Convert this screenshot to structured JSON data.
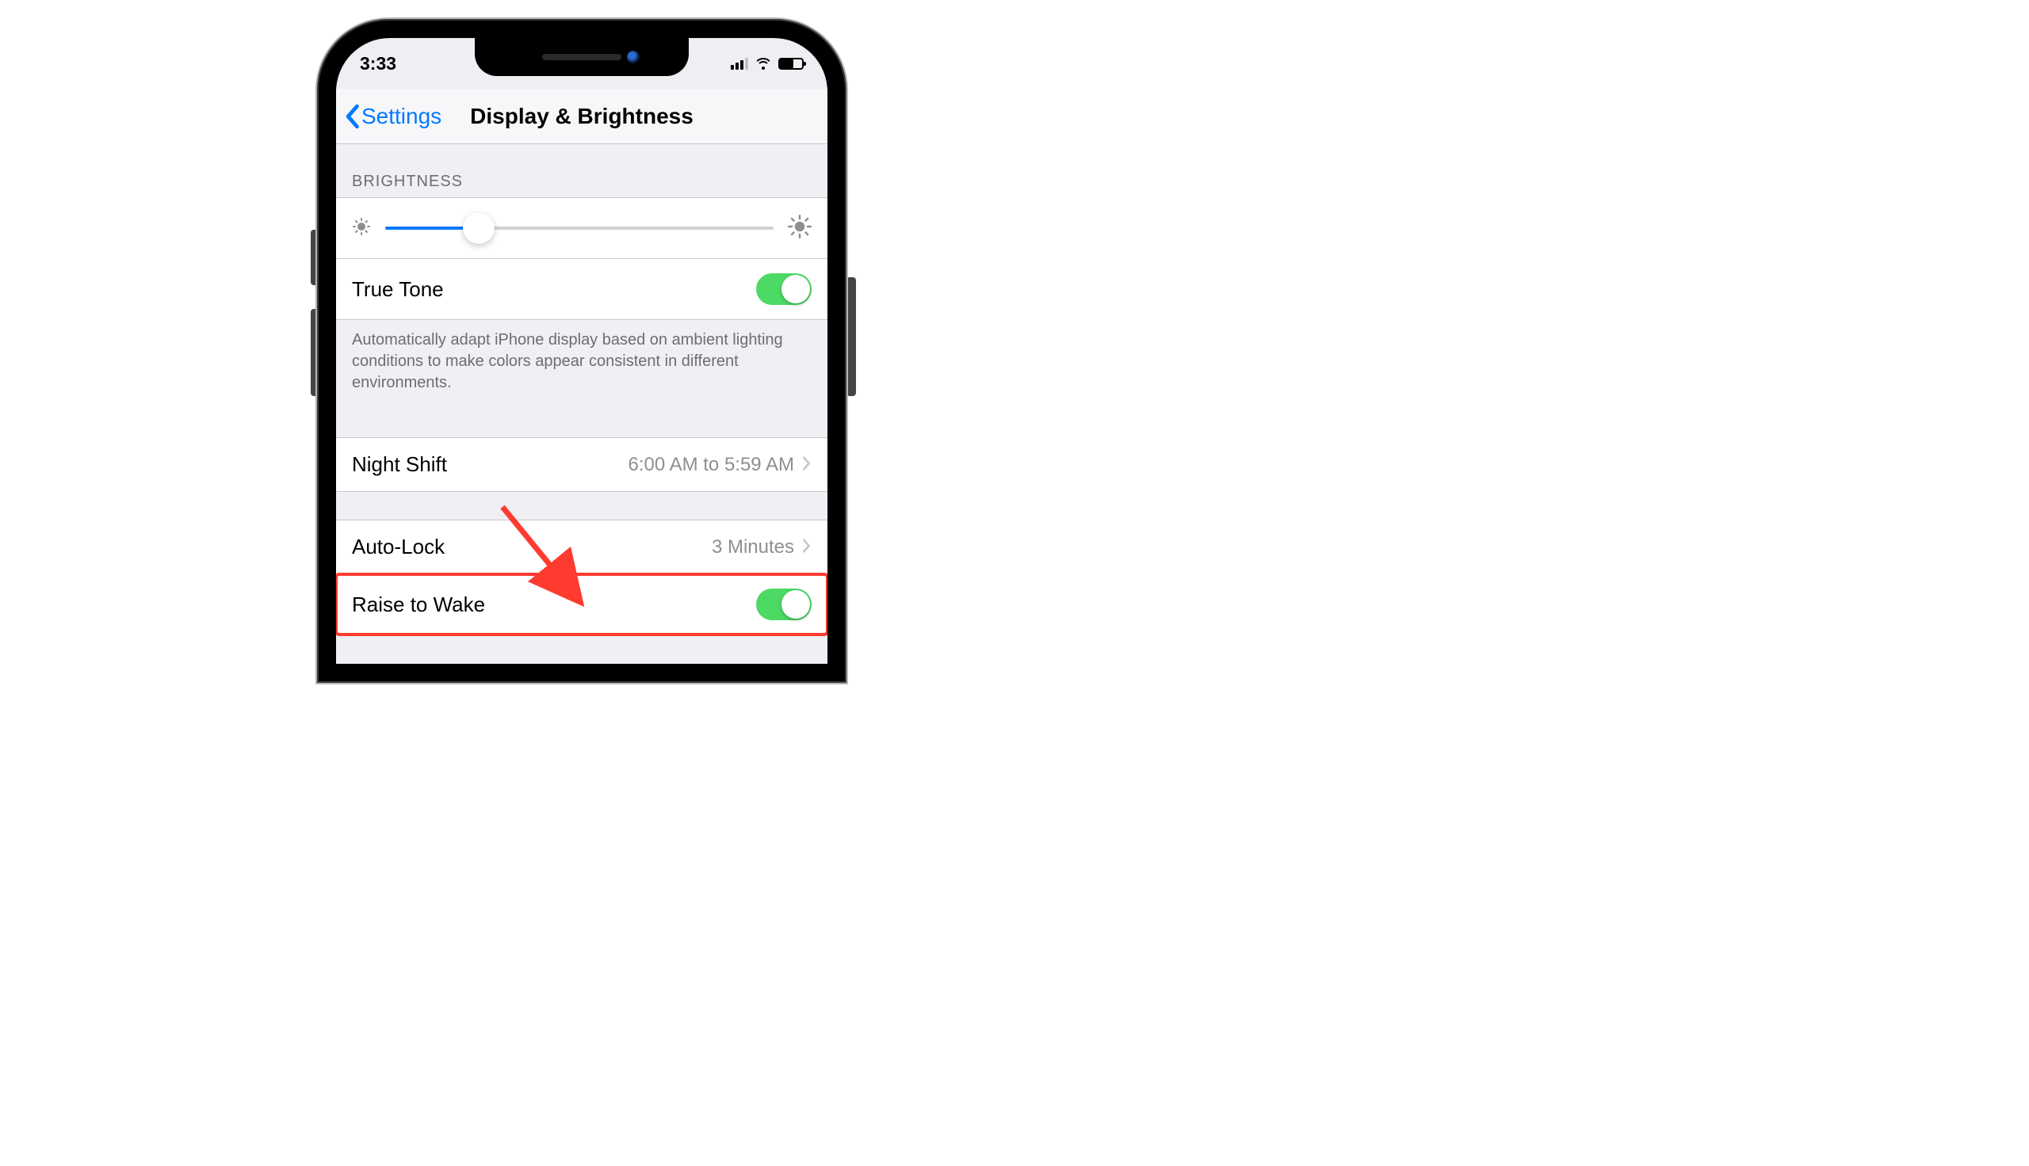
{
  "status_bar": {
    "time": "3:33"
  },
  "nav": {
    "back_label": "Settings",
    "title": "Display & Brightness"
  },
  "brightness": {
    "section_header": "BRIGHTNESS",
    "slider_pct": 24
  },
  "true_tone": {
    "label": "True Tone",
    "on": true,
    "footer": "Automatically adapt iPhone display based on ambient lighting conditions to make colors appear consistent in different environments."
  },
  "night_shift": {
    "label": "Night Shift",
    "value": "6:00 AM to 5:59 AM"
  },
  "auto_lock": {
    "label": "Auto-Lock",
    "value": "3 Minutes"
  },
  "raise_to_wake": {
    "label": "Raise to Wake",
    "on": true
  },
  "annotation": {
    "highlight_color": "#ff3b30"
  }
}
